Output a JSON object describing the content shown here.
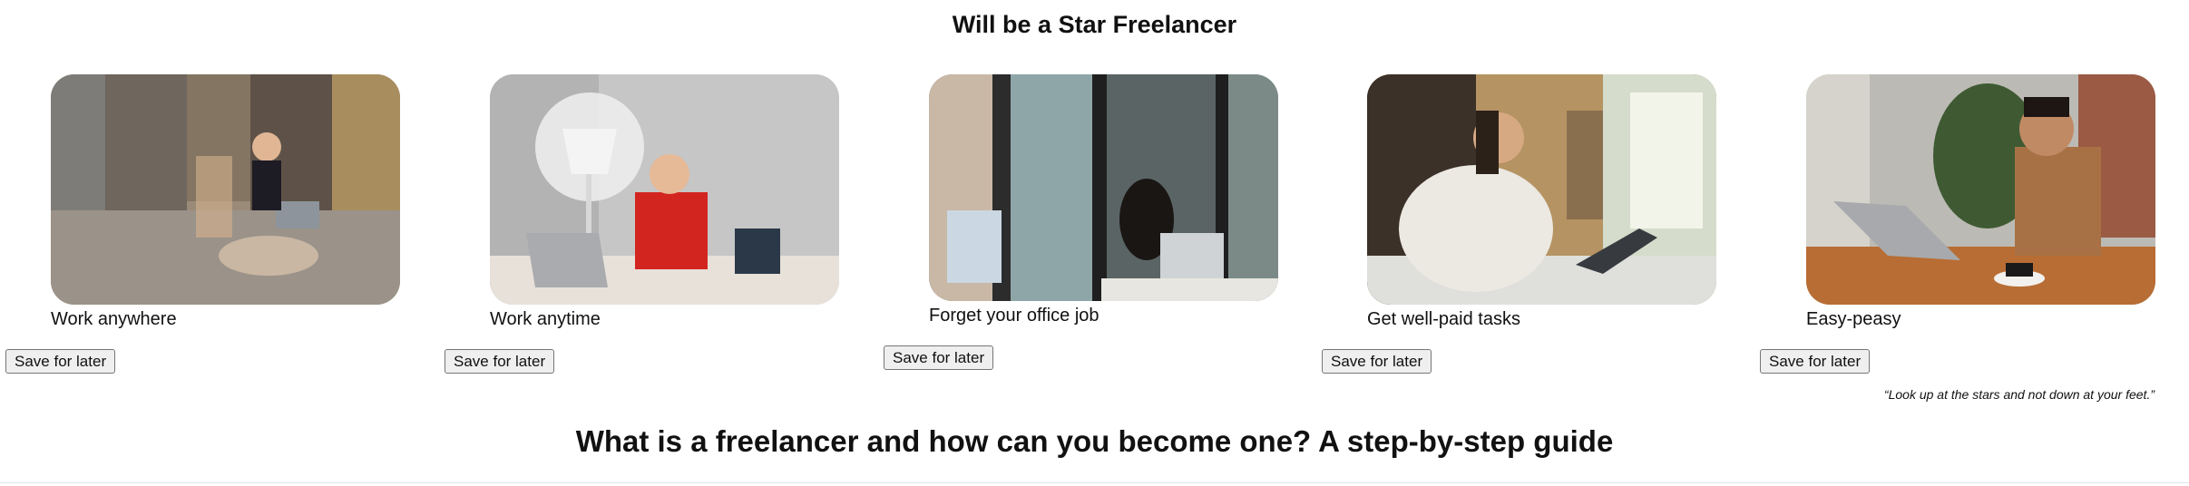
{
  "header": {
    "title": "Will be a Star Freelancer"
  },
  "cards": [
    {
      "caption": "Work anywhere",
      "image": "woman-with-laptop-on-street-photo",
      "button_label": "Save for later"
    },
    {
      "caption": "Work anytime",
      "image": "woman-at-desk-with-lamp-photo",
      "button_label": "Save for later"
    },
    {
      "caption": "Forget your office job",
      "image": "woman-in-cafe-with-laptop-photo",
      "button_label": "Save for later"
    },
    {
      "caption": "Get well-paid tasks",
      "image": "woman-in-kitchen-with-laptop-photo",
      "button_label": "Save for later"
    },
    {
      "caption": "Easy-peasy",
      "image": "man-at-wooden-table-with-laptop-photo",
      "button_label": "Save for later"
    }
  ],
  "quote": "“Look up at the stars and not down at your feet.”",
  "section": {
    "title": "What is a freelancer and how can you become one? A step-by-step guide"
  }
}
